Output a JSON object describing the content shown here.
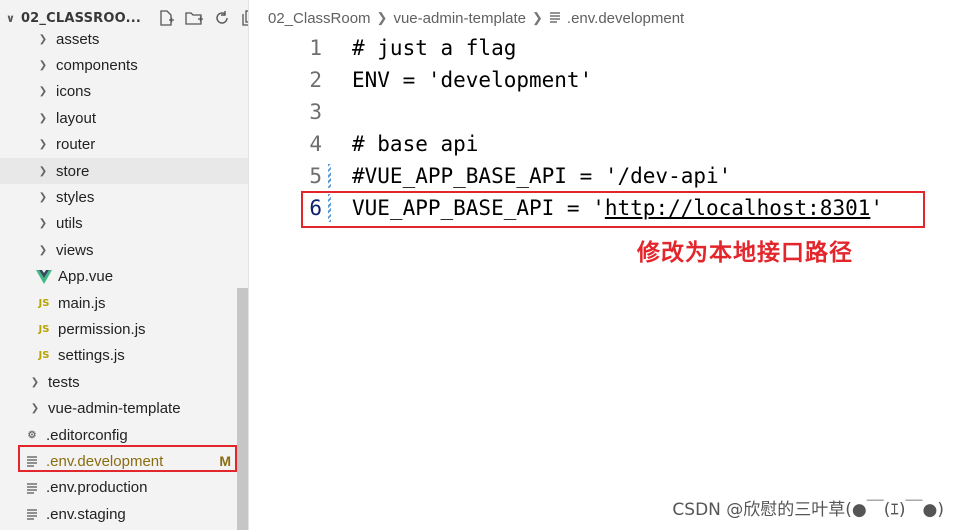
{
  "explorer": {
    "root_label": "02_CLASSROO...",
    "actions": [
      "new-file-icon",
      "new-folder-icon",
      "refresh-icon",
      "collapse-icon"
    ],
    "items": [
      {
        "label": "assets",
        "kind": "folder"
      },
      {
        "label": "components",
        "kind": "folder"
      },
      {
        "label": "icons",
        "kind": "folder"
      },
      {
        "label": "layout",
        "kind": "folder"
      },
      {
        "label": "router",
        "kind": "folder"
      },
      {
        "label": "store",
        "kind": "folder"
      },
      {
        "label": "styles",
        "kind": "folder"
      },
      {
        "label": "utils",
        "kind": "folder"
      },
      {
        "label": "views",
        "kind": "folder"
      },
      {
        "label": "App.vue",
        "kind": "vue"
      },
      {
        "label": "main.js",
        "kind": "js",
        "icon_text": "JS"
      },
      {
        "label": "permission.js",
        "kind": "js",
        "icon_text": "JS"
      },
      {
        "label": "settings.js",
        "kind": "js",
        "icon_text": "JS"
      },
      {
        "label": "tests",
        "kind": "folder"
      },
      {
        "label": "vue-admin-template",
        "kind": "folder"
      },
      {
        "label": ".editorconfig",
        "kind": "config"
      },
      {
        "label": ".env.development",
        "kind": "env",
        "badge": "M",
        "selected": true
      },
      {
        "label": ".env.production",
        "kind": "env"
      },
      {
        "label": ".env.staging",
        "kind": "env"
      }
    ]
  },
  "breadcrumb": {
    "parts": [
      "02_ClassRoom",
      "vue-admin-template",
      ".env.development"
    ]
  },
  "editor": {
    "lines": [
      {
        "num": "1",
        "text": "# just a flag"
      },
      {
        "num": "2",
        "text": "ENV = 'development'"
      },
      {
        "num": "3",
        "text": ""
      },
      {
        "num": "4",
        "text": "# base api"
      },
      {
        "num": "5",
        "text": "#VUE_APP_BASE_API = '/dev-api'"
      },
      {
        "num": "6",
        "text_prefix": "VUE_APP_BASE_API = '",
        "text_url": "http://localhost:8301",
        "text_suffix": "'"
      }
    ]
  },
  "annotation": {
    "text": "修改为本地接口路径",
    "color": "#e3262b"
  },
  "watermark": "CSDN @欣慰的三叶草(●￣(ｴ)￣●)",
  "colors": {
    "sidebar_bg": "#f3f3f3",
    "highlight_red": "#e3262b",
    "modified_badge": "#8a6d0f",
    "js_icon": "#b7a400",
    "vue_icon": "#41b883"
  }
}
